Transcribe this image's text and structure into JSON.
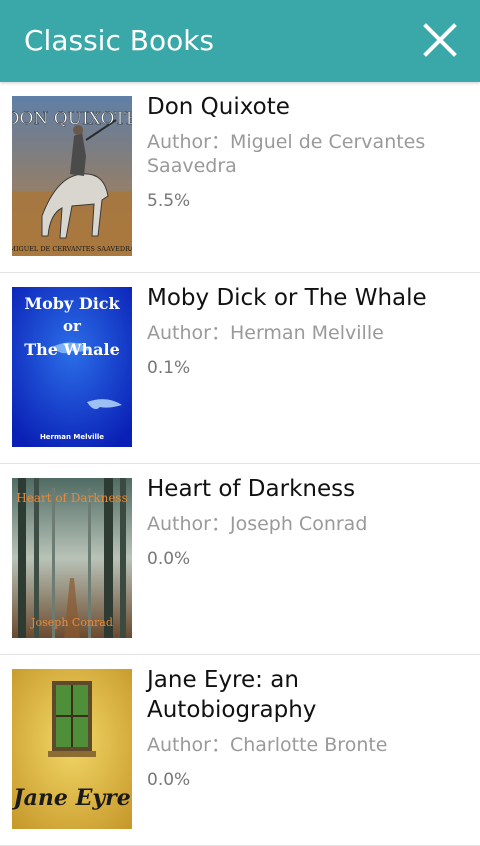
{
  "header": {
    "title": "Classic Books",
    "close_icon": "close-icon",
    "background_color": "#3aa8a8"
  },
  "books": [
    {
      "title": "Don Quixote",
      "author": "Author：Miguel de Cervantes Saavedra",
      "progress": "5.5%",
      "cover_title": "DON QUIXOTE",
      "cover_author": "MIGUEL DE CERVANTES SAAVEDRA"
    },
    {
      "title": "Moby Dick or The Whale",
      "author": "Author：Herman Melville",
      "progress": "0.1%",
      "cover_title_lines": [
        "Moby Dick",
        "or",
        "The Whale"
      ],
      "cover_author": "Herman Melville"
    },
    {
      "title": "Heart of Darkness",
      "author": "Author：Joseph Conrad",
      "progress": "0.0%",
      "cover_title": "Heart of Darkness",
      "cover_author": "Joseph Conrad"
    },
    {
      "title": "Jane Eyre: an Autobiography",
      "author": "Author：Charlotte Bronte",
      "progress": "0.0%",
      "cover_title": "Jane Eyre"
    }
  ]
}
